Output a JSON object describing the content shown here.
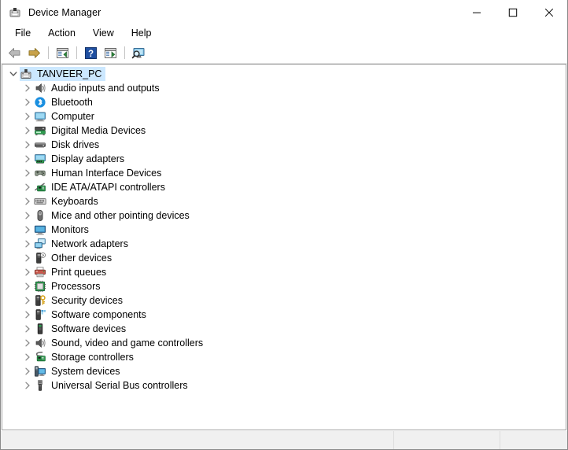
{
  "window": {
    "title": "Device Manager",
    "icon": "device-manager-icon",
    "controls": [
      {
        "name": "minimize-button",
        "glyph": "—"
      },
      {
        "name": "maximize-button",
        "glyph": "□"
      },
      {
        "name": "close-button",
        "glyph": "✕"
      }
    ]
  },
  "menubar": {
    "items": [
      {
        "label": "File"
      },
      {
        "label": "Action"
      },
      {
        "label": "View"
      },
      {
        "label": "Help"
      }
    ]
  },
  "toolbar": {
    "buttons": [
      {
        "name": "back-button",
        "icon": "back-arrow-icon",
        "tooltip": "Back"
      },
      {
        "name": "forward-button",
        "icon": "forward-arrow-icon",
        "tooltip": "Forward"
      },
      {
        "name": "separator-1",
        "icon": "separator"
      },
      {
        "name": "properties-button",
        "icon": "properties-window-icon",
        "tooltip": "Properties"
      },
      {
        "name": "separator-2",
        "icon": "separator"
      },
      {
        "name": "help-button",
        "icon": "help-question-icon",
        "tooltip": "Help"
      },
      {
        "name": "update-driver-button",
        "icon": "update-driver-icon",
        "tooltip": "Update driver"
      },
      {
        "name": "separator-3",
        "icon": "separator"
      },
      {
        "name": "scan-hardware-button",
        "icon": "scan-monitor-icon",
        "tooltip": "Scan for hardware changes"
      }
    ]
  },
  "tree": {
    "root": {
      "label": "TANVEER_PC",
      "icon": "computer-node-icon",
      "expanded": true,
      "selected": true
    },
    "items": [
      {
        "label": "Audio inputs and outputs",
        "icon": "speaker-icon",
        "expanded": false
      },
      {
        "label": "Bluetooth",
        "icon": "bluetooth-icon",
        "expanded": false
      },
      {
        "label": "Computer",
        "icon": "monitor-icon",
        "expanded": false
      },
      {
        "label": "Digital Media Devices",
        "icon": "media-device-icon",
        "expanded": false
      },
      {
        "label": "Disk drives",
        "icon": "disk-drive-icon",
        "expanded": false
      },
      {
        "label": "Display adapters",
        "icon": "display-adapter-icon",
        "expanded": false
      },
      {
        "label": "Human Interface Devices",
        "icon": "hid-gamepad-icon",
        "expanded": false
      },
      {
        "label": "IDE ATA/ATAPI controllers",
        "icon": "ide-controller-icon",
        "expanded": false
      },
      {
        "label": "Keyboards",
        "icon": "keyboard-icon",
        "expanded": false
      },
      {
        "label": "Mice and other pointing devices",
        "icon": "mouse-icon",
        "expanded": false
      },
      {
        "label": "Monitors",
        "icon": "monitor-screen-icon",
        "expanded": false
      },
      {
        "label": "Network adapters",
        "icon": "network-adapter-icon",
        "expanded": false
      },
      {
        "label": "Other devices",
        "icon": "unknown-device-icon",
        "expanded": false
      },
      {
        "label": "Print queues",
        "icon": "printer-icon",
        "expanded": false
      },
      {
        "label": "Processors",
        "icon": "processor-chip-icon",
        "expanded": false
      },
      {
        "label": "Security devices",
        "icon": "security-key-icon",
        "expanded": false
      },
      {
        "label": "Software components",
        "icon": "software-component-icon",
        "expanded": false
      },
      {
        "label": "Software devices",
        "icon": "software-device-icon",
        "expanded": false
      },
      {
        "label": "Sound, video and game controllers",
        "icon": "sound-speaker-icon",
        "expanded": false
      },
      {
        "label": "Storage controllers",
        "icon": "storage-controller-icon",
        "expanded": false
      },
      {
        "label": "System devices",
        "icon": "system-device-icon",
        "expanded": false
      },
      {
        "label": "Universal Serial Bus controllers",
        "icon": "usb-icon",
        "expanded": false
      }
    ]
  },
  "statusbar": {
    "panes": [
      {
        "text": ""
      },
      {
        "text": ""
      },
      {
        "text": ""
      }
    ]
  },
  "colors": {
    "selection": "#cce8ff",
    "window_bg": "#ffffff",
    "statusbar_bg": "#f0f0f0",
    "border": "#a0a0a0",
    "accent_blue": "#0078d7"
  }
}
